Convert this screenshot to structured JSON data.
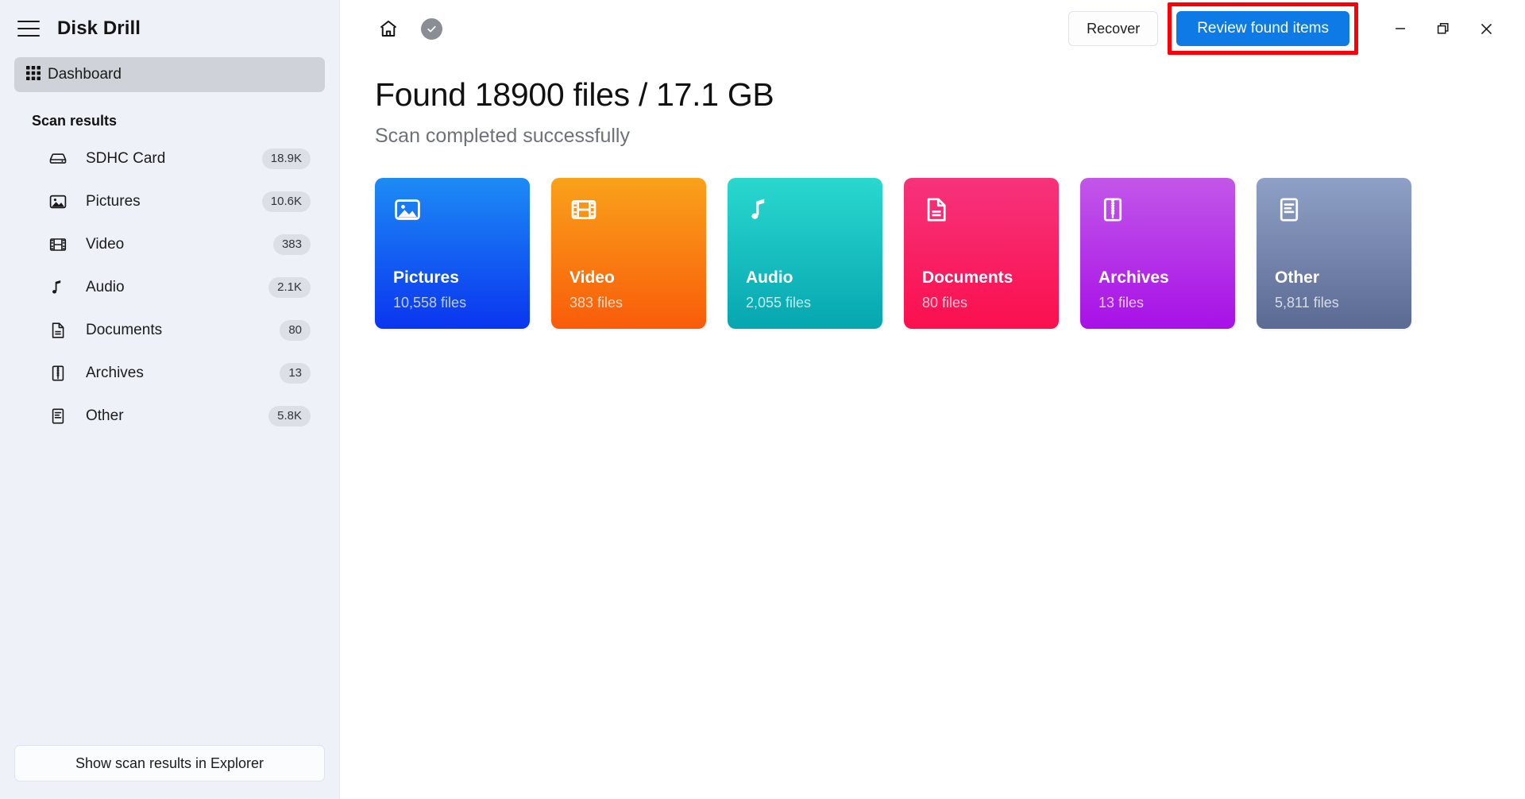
{
  "app": {
    "title": "Disk Drill",
    "menu_icon": "hamburger-icon"
  },
  "sidebar": {
    "dashboard": {
      "label": "Dashboard",
      "icon": "grid-icon"
    },
    "section_label": "Scan results",
    "items": [
      {
        "label": "SDHC Card",
        "badge": "18.9K",
        "icon": "disk-icon"
      },
      {
        "label": "Pictures",
        "badge": "10.6K",
        "icon": "image-icon"
      },
      {
        "label": "Video",
        "badge": "383",
        "icon": "film-icon"
      },
      {
        "label": "Audio",
        "badge": "2.1K",
        "icon": "music-note-icon"
      },
      {
        "label": "Documents",
        "badge": "80",
        "icon": "document-icon"
      },
      {
        "label": "Archives",
        "badge": "13",
        "icon": "archive-zip-icon"
      },
      {
        "label": "Other",
        "badge": "5.8K",
        "icon": "file-lines-icon"
      }
    ],
    "explorer_button": "Show scan results in Explorer"
  },
  "topbar": {
    "home_icon": "home-icon",
    "status_icon": "check-circle-icon",
    "recover_label": "Recover",
    "review_label": "Review found items",
    "minimize_icon": "minimize-icon",
    "restore_icon": "restore-icon",
    "close_icon": "close-icon",
    "highlight_color": "#fb0007",
    "review_button_color": "#0e7ae5"
  },
  "main": {
    "title": "Found 18900 files / 17.1 GB",
    "subtitle": "Scan completed successfully",
    "cards": [
      {
        "title": "Pictures",
        "count": "10,558 files",
        "icon": "image-icon",
        "color_top": "#1d8bf4",
        "color_bottom": "#0a35f0"
      },
      {
        "title": "Video",
        "count": "383 files",
        "icon": "film-icon",
        "color_top": "#f9a21b",
        "color_bottom": "#f95c09"
      },
      {
        "title": "Audio",
        "count": "2,055 files",
        "icon": "music-note-icon",
        "color_top": "#2ad8cf",
        "color_bottom": "#06a6b0"
      },
      {
        "title": "Documents",
        "count": "80 files",
        "icon": "document-icon",
        "color_top": "#f6337c",
        "color_bottom": "#fb0f4e"
      },
      {
        "title": "Archives",
        "count": "13 files",
        "icon": "archive-zip-icon",
        "color_top": "#c257e8",
        "color_bottom": "#a711e7"
      },
      {
        "title": "Other",
        "count": "5,811 files",
        "icon": "file-lines-icon",
        "color_top": "#8fa0c6",
        "color_bottom": "#5b6a93"
      }
    ]
  }
}
